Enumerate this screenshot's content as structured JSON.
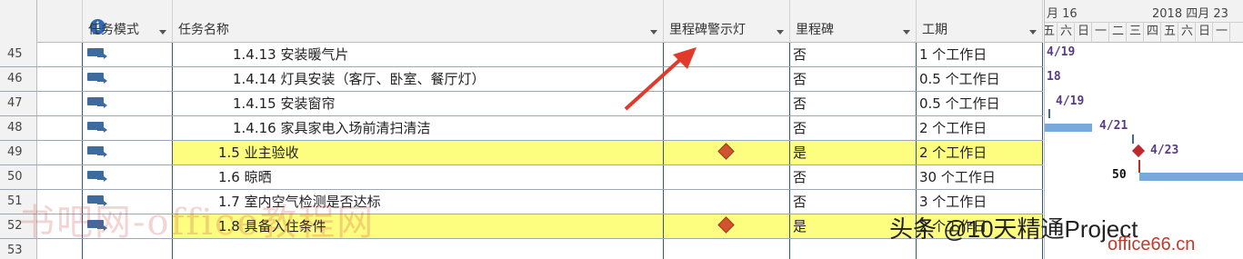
{
  "columns": {
    "info": "i",
    "mode": "任务模式",
    "name": "任务名称",
    "warning": "里程碑警示灯",
    "milestone": "里程碑",
    "duration": "工期"
  },
  "rows": [
    {
      "num": "45",
      "name": "1.4.13 安装暖气片",
      "milestone": "否",
      "duration": "1 个工作日",
      "highlight": false,
      "warning_icon": false
    },
    {
      "num": "46",
      "name": "1.4.14 灯具安装（客厅、卧室、餐厅灯）",
      "milestone": "否",
      "duration": "0.5 个工作日",
      "highlight": false,
      "warning_icon": false
    },
    {
      "num": "47",
      "name": "1.4.15 安装窗帘",
      "milestone": "否",
      "duration": "0.5 个工作日",
      "highlight": false,
      "warning_icon": false
    },
    {
      "num": "48",
      "name": "1.4.16 家具家电入场前清扫清洁",
      "milestone": "否",
      "duration": "2 个工作日",
      "highlight": false,
      "warning_icon": false
    },
    {
      "num": "49",
      "name": "1.5 业主验收",
      "milestone": "是",
      "duration": "2 个工作日",
      "highlight": true,
      "warning_icon": true
    },
    {
      "num": "50",
      "name": "1.6 晾晒",
      "milestone": "否",
      "duration": "30 个工作日",
      "highlight": false,
      "warning_icon": false
    },
    {
      "num": "51",
      "name": "1.7 室内空气检测是否达标",
      "milestone": "否",
      "duration": "3 个工作日",
      "highlight": false,
      "warning_icon": false
    },
    {
      "num": "52",
      "name": "1.8 具备入住条件",
      "milestone": "是",
      "duration": "2 个工作日",
      "highlight": true,
      "warning_icon": true
    },
    {
      "num": "53",
      "name": "",
      "milestone": "",
      "duration": "",
      "highlight": false,
      "warning_icon": false
    }
  ],
  "timescale": {
    "week1": "月 16",
    "week2": "2018 四月 23",
    "days": [
      "五",
      "六",
      "日",
      "一",
      "二",
      "三",
      "四",
      "五",
      "六",
      "日",
      "一"
    ]
  },
  "gantt_labels": {
    "r45": "4/19",
    "r46": "18",
    "r47": "4/19",
    "r48": "4/21",
    "r49": "4/23",
    "r50": "50"
  },
  "watermarks": {
    "left": "书吧网-office教程网",
    "right": "头条 @10天精通Project",
    "site": "office66.cn"
  },
  "colors": {
    "highlight": "#fdfd80",
    "diamond": "#d0542e",
    "gantt_bar": "#78a9dc",
    "arrow": "#e23a2a"
  }
}
